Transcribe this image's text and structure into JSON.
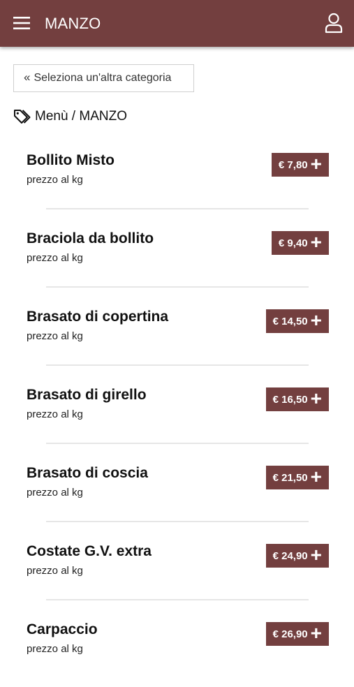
{
  "header": {
    "title": "MANZO",
    "menu_icon": "hamburger-menu-icon",
    "user_icon": "user-icon",
    "brand_color": "#733f3f"
  },
  "back_button": {
    "chevron": "«",
    "label": "Seleziona un'altra categoria"
  },
  "breadcrumb": {
    "icon": "tags-icon",
    "text": "Menù / MANZO"
  },
  "items": [
    {
      "name": "Bollito Misto",
      "unit": "prezzo al kg",
      "price": "€ 7,80"
    },
    {
      "name": "Braciola da bollito",
      "unit": "prezzo al kg",
      "price": "€ 9,40"
    },
    {
      "name": "Brasato di copertina",
      "unit": "prezzo al kg",
      "price": "€ 14,50"
    },
    {
      "name": "Brasato di girello",
      "unit": "prezzo al kg",
      "price": "€ 16,50"
    },
    {
      "name": "Brasato di coscia",
      "unit": "prezzo al kg",
      "price": "€ 21,50"
    },
    {
      "name": "Costate G.V. extra",
      "unit": "prezzo al kg",
      "price": "€ 24,90"
    },
    {
      "name": "Carpaccio",
      "unit": "prezzo al kg",
      "price": "€ 26,90"
    }
  ],
  "add_symbol": "+"
}
